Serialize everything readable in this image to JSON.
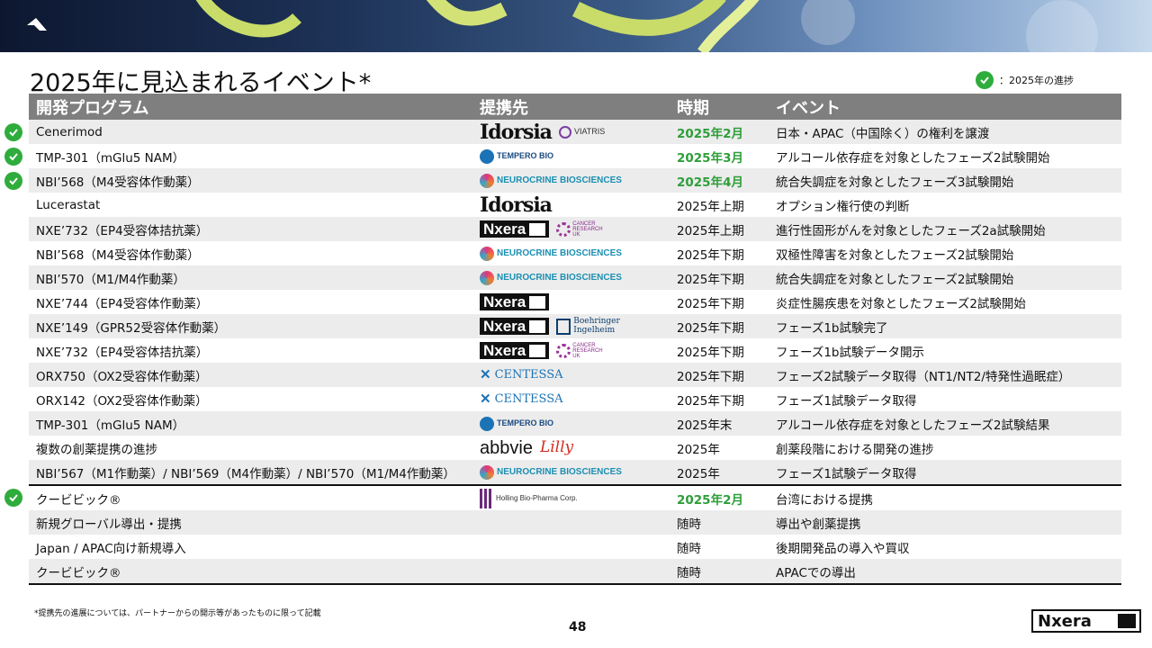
{
  "title": "2025年に見込まれるイベント*",
  "legend": {
    "label": "：2025年の進捗"
  },
  "colors": {
    "check": "#2eac3c",
    "done_text": "#2e9e3a",
    "header_bg": "#7f7f7f"
  },
  "table": {
    "headers": [
      "開発プログラム",
      "提携先",
      "時期",
      "イベント"
    ],
    "rows": [
      {
        "program": "Cenerimod",
        "partners": [
          "Idorsia",
          "VIATRIS"
        ],
        "timing": "2025年2月",
        "event": "日本・APAC（中国除く）の権利を譲渡",
        "done": true
      },
      {
        "program": "TMP-301（mGlu5 NAM）",
        "partners": [
          "TEMPERO BIO"
        ],
        "timing": "2025年3月",
        "event": "アルコール依存症を対象としたフェーズ2試験開始",
        "done": true
      },
      {
        "program": "NBI’568（M4受容体作動薬）",
        "partners": [
          "NEUROCRINE BIOSCIENCES"
        ],
        "timing": "2025年4月",
        "event": "統合失調症を対象としたフェーズ3試験開始",
        "done": true
      },
      {
        "program": "Lucerastat",
        "partners": [
          "Idorsia"
        ],
        "timing": "2025年上期",
        "event": "オプション権行使の判断",
        "done": false
      },
      {
        "program": "NXE’732（EP4受容体拮抗薬）",
        "partners": [
          "Nxera",
          "CANCER RESEARCH UK"
        ],
        "timing": "2025年上期",
        "event": "進行性固形がんを対象としたフェーズ2a試験開始",
        "done": false
      },
      {
        "program": "NBI’568（M4受容体作動薬）",
        "partners": [
          "NEUROCRINE BIOSCIENCES"
        ],
        "timing": "2025年下期",
        "event": "双極性障害を対象としたフェーズ2試験開始",
        "done": false
      },
      {
        "program": "NBI’570（M1/M4作動薬）",
        "partners": [
          "NEUROCRINE BIOSCIENCES"
        ],
        "timing": "2025年下期",
        "event": "統合失調症を対象としたフェーズ2試験開始",
        "done": false
      },
      {
        "program": "NXE’744（EP4受容体作動薬）",
        "partners": [
          "Nxera"
        ],
        "timing": "2025年下期",
        "event": "炎症性腸疾患を対象としたフェーズ2試験開始",
        "done": false
      },
      {
        "program": "NXE’149（GPR52受容体作動薬）",
        "partners": [
          "Nxera",
          "Boehringer Ingelheim"
        ],
        "timing": "2025年下期",
        "event": "フェーズ1b試験完了",
        "done": false
      },
      {
        "program": "NXE’732（EP4受容体拮抗薬）",
        "partners": [
          "Nxera",
          "CANCER RESEARCH UK"
        ],
        "timing": "2025年下期",
        "event": "フェーズ1b試験データ開示",
        "done": false
      },
      {
        "program": "ORX750（OX2受容体作動薬）",
        "partners": [
          "CENTESSA"
        ],
        "timing": "2025年下期",
        "event": "フェーズ2試験データ取得（NT1/NT2/特発性過眠症）",
        "done": false
      },
      {
        "program": "ORX142（OX2受容体作動薬）",
        "partners": [
          "CENTESSA"
        ],
        "timing": "2025年下期",
        "event": "フェーズ1試験データ取得",
        "done": false
      },
      {
        "program": "TMP-301（mGlu5 NAM）",
        "partners": [
          "TEMPERO BIO"
        ],
        "timing": "2025年末",
        "event": "アルコール依存症を対象としたフェーズ2試験結果",
        "done": false
      },
      {
        "program": "複数の創薬提携の進捗",
        "partners": [
          "abbvie",
          "Lilly"
        ],
        "timing": "2025年",
        "event": "創薬段階における開発の進捗",
        "done": false
      },
      {
        "program": "NBI’567（M1作動薬）/ NBI’569（M4作動薬）/ NBI’570（M1/M4作動薬）",
        "partners": [
          "NEUROCRINE BIOSCIENCES"
        ],
        "timing": "2025年",
        "event": "フェーズ1試験データ取得",
        "done": false
      },
      {
        "program": "クービビック®",
        "partners": [
          "Holling Bio-Pharma Corp."
        ],
        "timing": "2025年2月",
        "event": "台湾における提携",
        "done": true
      },
      {
        "program": "新規グローバル導出・提携",
        "partners": [],
        "timing": "随時",
        "event": "導出や創薬提携",
        "done": false
      },
      {
        "program": "Japan / APAC向け新規導入",
        "partners": [],
        "timing": "随時",
        "event": "後期開発品の導入や買収",
        "done": false
      },
      {
        "program": "クービビック®",
        "partners": [],
        "timing": "随時",
        "event": "APACでの導出",
        "done": false
      }
    ]
  },
  "footnote": "*提携先の進展については、パートナーからの開示等があったものに限って記載",
  "page_number": "48",
  "brand": "Nxera"
}
